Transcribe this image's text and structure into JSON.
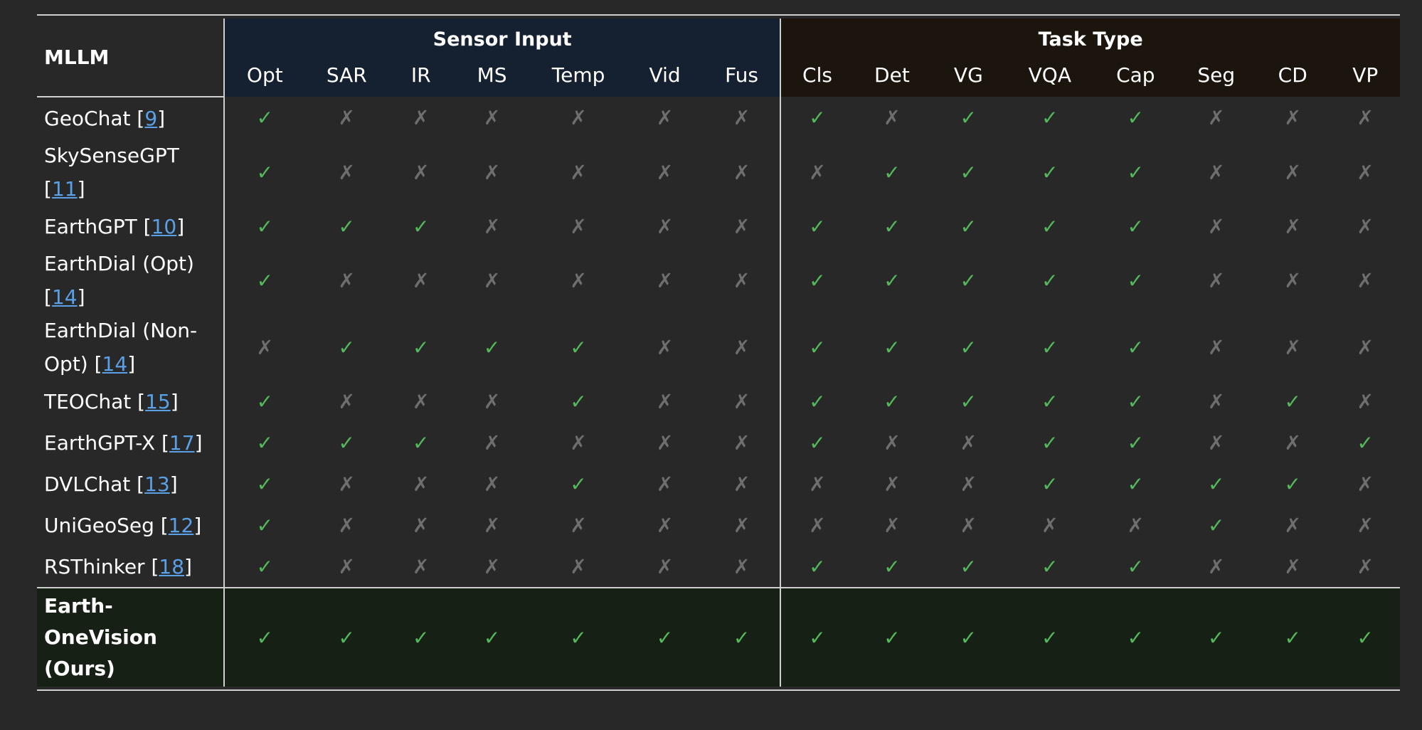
{
  "header": {
    "mllm_label": "MLLM",
    "sensor_group": "Sensor Input",
    "task_group": "Task Type",
    "sensor_cols": [
      "Opt",
      "SAR",
      "IR",
      "MS",
      "Temp",
      "Vid",
      "Fus"
    ],
    "task_cols": [
      "Cls",
      "Det",
      "VG",
      "VQA",
      "Cap",
      "Seg",
      "CD",
      "VP"
    ]
  },
  "marks": {
    "yes": "✓",
    "no": "✗"
  },
  "colors": {
    "check": "#53b95a",
    "cross": "#6e6e6e",
    "link": "#5aa0e6",
    "sensor_header_bg": "#152130",
    "task_header_bg": "#1c150e",
    "ours_row_bg": "#172015"
  },
  "rows": [
    {
      "name": "GeoChat [",
      "ref": "9",
      "end": "]",
      "lines": 1,
      "sensor": [
        1,
        0,
        0,
        0,
        0,
        0,
        0
      ],
      "task": [
        1,
        0,
        1,
        1,
        1,
        0,
        0,
        0
      ]
    },
    {
      "name": "SkySenseGPT [",
      "ref": "11",
      "end": "]",
      "lines": 2,
      "sensor": [
        1,
        0,
        0,
        0,
        0,
        0,
        0
      ],
      "task": [
        0,
        1,
        1,
        1,
        1,
        0,
        0,
        0
      ]
    },
    {
      "name": "EarthGPT [",
      "ref": "10",
      "end": "]",
      "lines": 1,
      "sensor": [
        1,
        1,
        1,
        0,
        0,
        0,
        0
      ],
      "task": [
        1,
        1,
        1,
        1,
        1,
        0,
        0,
        0
      ]
    },
    {
      "name": "EarthDial (Opt) [",
      "ref": "14",
      "end": "]",
      "lines": 2,
      "sensor": [
        1,
        0,
        0,
        0,
        0,
        0,
        0
      ],
      "task": [
        1,
        1,
        1,
        1,
        1,
        0,
        0,
        0
      ]
    },
    {
      "name": "EarthDial (Non-Opt) [",
      "ref": "14",
      "end": "]",
      "lines": 2,
      "sensor": [
        0,
        1,
        1,
        1,
        1,
        0,
        0
      ],
      "task": [
        1,
        1,
        1,
        1,
        1,
        0,
        0,
        0
      ]
    },
    {
      "name": "TEOChat [",
      "ref": "15",
      "end": "]",
      "lines": 1,
      "sensor": [
        1,
        0,
        0,
        0,
        1,
        0,
        0
      ],
      "task": [
        1,
        1,
        1,
        1,
        1,
        0,
        1,
        0
      ]
    },
    {
      "name": "EarthGPT-X [",
      "ref": "17",
      "end": "]",
      "lines": 1,
      "sensor": [
        1,
        1,
        1,
        0,
        0,
        0,
        0
      ],
      "task": [
        1,
        0,
        0,
        1,
        1,
        0,
        0,
        1
      ]
    },
    {
      "name": "DVLChat [",
      "ref": "13",
      "end": "]",
      "lines": 1,
      "sensor": [
        1,
        0,
        0,
        0,
        1,
        0,
        0
      ],
      "task": [
        0,
        0,
        0,
        1,
        1,
        1,
        1,
        0
      ]
    },
    {
      "name": "UniGeoSeg [",
      "ref": "12",
      "end": "]",
      "lines": 1,
      "sensor": [
        1,
        0,
        0,
        0,
        0,
        0,
        0
      ],
      "task": [
        0,
        0,
        0,
        0,
        0,
        1,
        0,
        0
      ]
    },
    {
      "name": "RSThinker [",
      "ref": "18",
      "end": "]",
      "lines": 1,
      "sensor": [
        1,
        0,
        0,
        0,
        0,
        0,
        0
      ],
      "task": [
        1,
        1,
        1,
        1,
        1,
        0,
        0,
        0
      ]
    }
  ],
  "ours": {
    "name_lines": [
      "Earth-",
      "OneVision",
      "(Ours)"
    ],
    "sensor": [
      1,
      1,
      1,
      1,
      1,
      1,
      1
    ],
    "task": [
      1,
      1,
      1,
      1,
      1,
      1,
      1,
      1
    ]
  }
}
